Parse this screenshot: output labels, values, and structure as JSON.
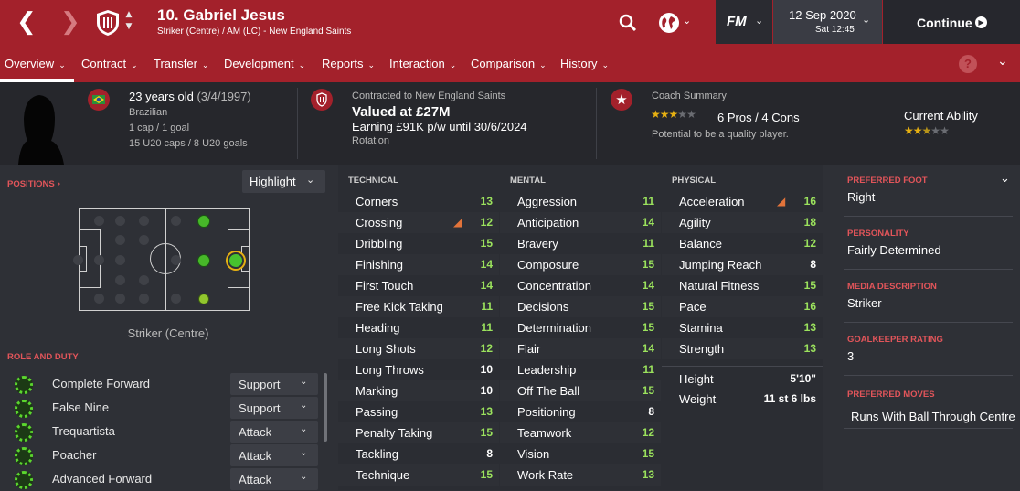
{
  "header": {
    "player_title": "10. Gabriel Jesus",
    "player_subtitle": "Striker (Centre) / AM (LC) - New England Saints",
    "fm_label": "FM",
    "date": "12 Sep 2020",
    "time": "Sat 12:45",
    "continue_label": "Continue"
  },
  "menu": [
    "Overview",
    "Contract",
    "Transfer",
    "Development",
    "Reports",
    "Interaction",
    "Comparison",
    "History"
  ],
  "help_label": "?",
  "info": {
    "age": "23 years old",
    "dob": "(3/4/1997)",
    "nationality": "Brazilian",
    "caps": "1 cap / 1 goal",
    "u20": "15 U20 caps / 8 U20 goals",
    "contract_to": "Contracted to New England Saints",
    "value": "Valued at £27M",
    "earning": "Earning £91K p/w until 30/6/2024",
    "squad_status": "Rotation",
    "coach_title": "Coach Summary",
    "coach_rating": 3,
    "pros_cons": "6 Pros / 4 Cons",
    "potential": "Potential to be a quality player.",
    "current_ability_label": "Current Ability",
    "current_ability_stars": 2.5
  },
  "positions": {
    "title": "POSITIONS",
    "highlight_label": "Highlight",
    "caption": "Striker (Centre)"
  },
  "roles": {
    "title": "ROLE AND DUTY",
    "items": [
      {
        "name": "Complete Forward",
        "duty": "Support"
      },
      {
        "name": "False Nine",
        "duty": "Support"
      },
      {
        "name": "Trequartista",
        "duty": "Attack"
      },
      {
        "name": "Poacher",
        "duty": "Attack"
      },
      {
        "name": "Advanced Forward",
        "duty": "Attack"
      }
    ]
  },
  "attributes": {
    "technical": {
      "title": "TECHNICAL",
      "items": [
        {
          "name": "Corners",
          "value": "13"
        },
        {
          "name": "Crossing",
          "value": "12"
        },
        {
          "name": "Dribbling",
          "value": "15"
        },
        {
          "name": "Finishing",
          "value": "14"
        },
        {
          "name": "First Touch",
          "value": "14"
        },
        {
          "name": "Free Kick Taking",
          "value": "11"
        },
        {
          "name": "Heading",
          "value": "11"
        },
        {
          "name": "Long Shots",
          "value": "12"
        },
        {
          "name": "Long Throws",
          "value": "10"
        },
        {
          "name": "Marking",
          "value": "10"
        },
        {
          "name": "Passing",
          "value": "13"
        },
        {
          "name": "Penalty Taking",
          "value": "15"
        },
        {
          "name": "Tackling",
          "value": "8"
        },
        {
          "name": "Technique",
          "value": "15"
        }
      ]
    },
    "mental": {
      "title": "MENTAL",
      "items": [
        {
          "name": "Aggression",
          "value": "11"
        },
        {
          "name": "Anticipation",
          "value": "14"
        },
        {
          "name": "Bravery",
          "value": "11"
        },
        {
          "name": "Composure",
          "value": "15"
        },
        {
          "name": "Concentration",
          "value": "14"
        },
        {
          "name": "Decisions",
          "value": "15"
        },
        {
          "name": "Determination",
          "value": "15"
        },
        {
          "name": "Flair",
          "value": "14"
        },
        {
          "name": "Leadership",
          "value": "11"
        },
        {
          "name": "Off The Ball",
          "value": "15"
        },
        {
          "name": "Positioning",
          "value": "8"
        },
        {
          "name": "Teamwork",
          "value": "12"
        },
        {
          "name": "Vision",
          "value": "15"
        },
        {
          "name": "Work Rate",
          "value": "13"
        }
      ]
    },
    "physical": {
      "title": "PHYSICAL",
      "items": [
        {
          "name": "Acceleration",
          "value": "16"
        },
        {
          "name": "Agility",
          "value": "18"
        },
        {
          "name": "Balance",
          "value": "12"
        },
        {
          "name": "Jumping Reach",
          "value": "8"
        },
        {
          "name": "Natural Fitness",
          "value": "15"
        },
        {
          "name": "Pace",
          "value": "16"
        },
        {
          "name": "Stamina",
          "value": "13"
        },
        {
          "name": "Strength",
          "value": "13"
        }
      ],
      "height_label": "Height",
      "height": "5'10\"",
      "weight_label": "Weight",
      "weight": "11 st 6 lbs"
    }
  },
  "side": {
    "preferred_foot_label": "PREFERRED FOOT",
    "preferred_foot": "Right",
    "personality_label": "PERSONALITY",
    "personality": "Fairly Determined",
    "media_label": "MEDIA DESCRIPTION",
    "media": "Striker",
    "gk_label": "GOALKEEPER RATING",
    "gk": "3",
    "moves_label": "PREFERRED MOVES",
    "moves": "Runs With Ball Through Centre"
  },
  "colors": {
    "header_red": "#a3212b",
    "value_high": "#9be25d",
    "value_mid": "#ffffff",
    "section_red": "#e2555a"
  }
}
